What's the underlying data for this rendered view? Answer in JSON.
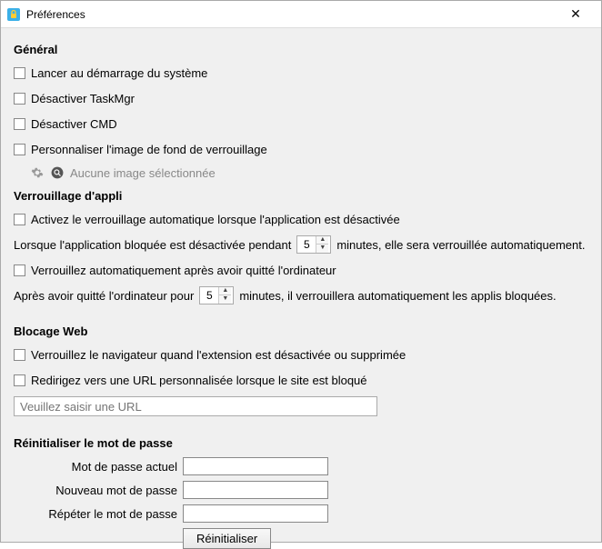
{
  "window": {
    "title": "Préférences"
  },
  "general": {
    "heading": "Général",
    "launch_startup": "Lancer au démarrage du système",
    "disable_taskmgr": "Désactiver TaskMgr",
    "disable_cmd": "Désactiver CMD",
    "custom_lock_image": "Personnaliser l'image de fond de verrouillage",
    "no_image_selected": "Aucune image sélectionnée"
  },
  "applock": {
    "heading": "Verrouillage d'appli",
    "auto_lock_when_disabled": "Activez le verrouillage automatique lorsque l'application est désactivée",
    "sentence_a_pre": "Lorsque l'application bloquée est désactivée pendant",
    "sentence_a_val": "5",
    "sentence_a_post": "minutes, elle sera verrouillée automatiquement.",
    "auto_lock_after_leave": "Verrouillez automatiquement après avoir quitté l'ordinateur",
    "sentence_b_pre": "Après avoir quitté l'ordinateur pour",
    "sentence_b_val": "5",
    "sentence_b_post": "minutes, il verrouillera automatiquement les applis bloquées."
  },
  "webblock": {
    "heading": "Blocage Web",
    "lock_browser_ext": "Verrouillez le navigateur quand l'extension est désactivée ou supprimée",
    "redirect_custom_url": "Redirigez vers une URL personnalisée lorsque le site est bloqué",
    "url_placeholder": "Veuillez saisir une URL"
  },
  "reset_pw": {
    "heading": "Réinitialiser le mot de passe",
    "current": "Mot de passe actuel",
    "new": "Nouveau mot de passe",
    "repeat": "Répéter le mot de passe",
    "button": "Réinitialiser"
  }
}
